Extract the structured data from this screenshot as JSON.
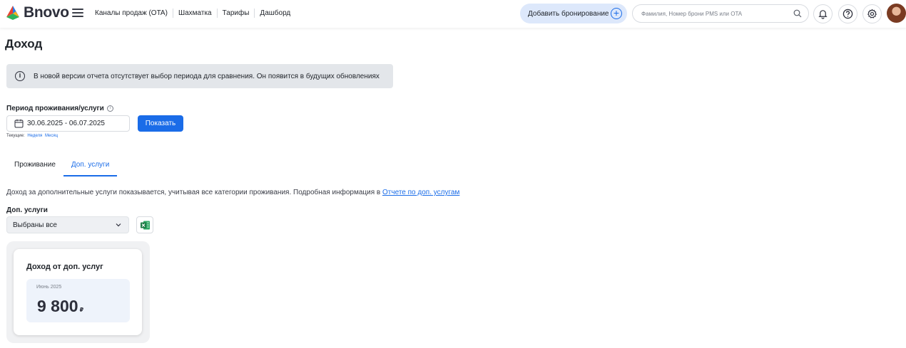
{
  "header": {
    "logo_text": "Bnovo",
    "nav": [
      {
        "label": "Каналы продаж (OTA)"
      },
      {
        "label": "Шахматка"
      },
      {
        "label": "Тарифы"
      },
      {
        "label": "Дашборд"
      }
    ],
    "add_booking_label": "Добавить бронирование",
    "search_placeholder": "Фамилия, Номер брони PMS или OTA"
  },
  "page": {
    "title": "Доход",
    "notice": "В новой версии отчета отсутствует выбор периода для сравнения. Он появится в будущих обновлениях",
    "period_label": "Период проживания/услуги",
    "date_range": "30.06.2025 - 06.07.2025",
    "show_label": "Показать",
    "current_label": "Текущие:",
    "current_links": [
      "Неделя",
      "Месяц"
    ],
    "tabs": [
      {
        "label": "Проживание",
        "active": false
      },
      {
        "label": "Доп. услуги",
        "active": true
      }
    ],
    "description": "Доход за дополнительные услуги показывается, учитывая все категории проживания. Подробная информация в ",
    "description_link": "Отчете по доп. услугам",
    "services_label": "Доп. услуги",
    "services_selected": "Выбраны все"
  },
  "card": {
    "title": "Доход от доп. услуг",
    "month": "Июнь 2025",
    "value": "9 800",
    "currency": "₽"
  },
  "colors": {
    "accent": "#1a6ce8",
    "notice_bg": "#e3e6ea",
    "add_booking_bg": "#dde8fb",
    "excel_green": "#1d7a45"
  }
}
